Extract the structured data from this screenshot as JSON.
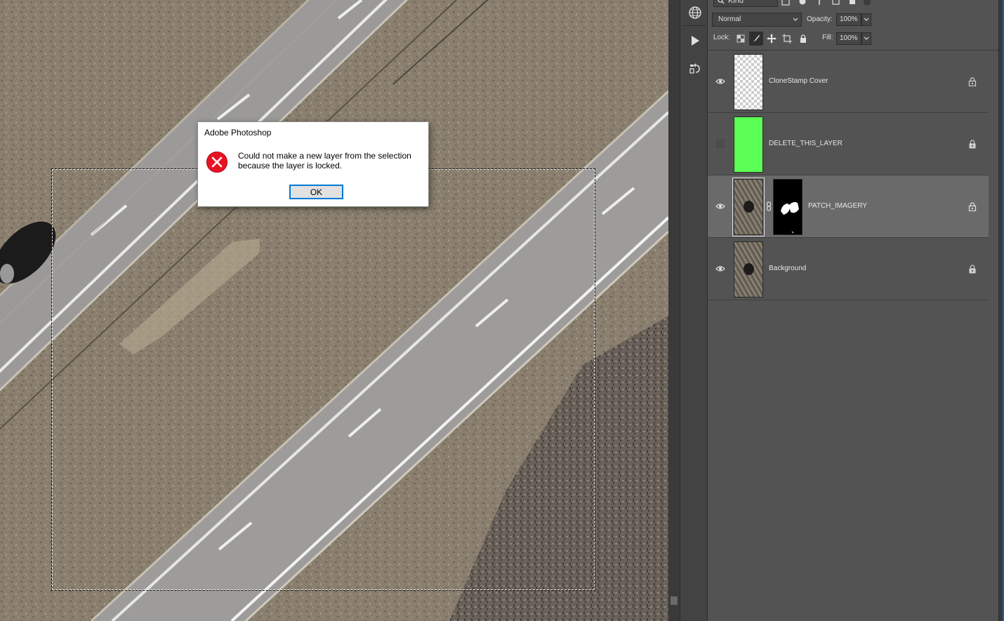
{
  "dialog": {
    "title": "Adobe Photoshop",
    "message_line1": "Could not make a new layer from the selection",
    "message_line2": "because the layer is locked.",
    "ok_label": "OK"
  },
  "layers_panel": {
    "filter_kind": "Kind",
    "blend_mode": "Normal",
    "opacity_label": "Opacity:",
    "opacity_value": "100%",
    "lock_label": "Lock:",
    "fill_label": "Fill:",
    "fill_value": "100%",
    "layers": [
      {
        "name": "CloneStamp Cover",
        "visible": true,
        "locked": true,
        "thumbnail": "transparent"
      },
      {
        "name": "DELETE_THIS_LAYER",
        "visible": false,
        "locked": true,
        "thumbnail": "green",
        "color": "#5cff55"
      },
      {
        "name": "PATCH_IMAGERY",
        "visible": true,
        "locked": true,
        "selected": true,
        "thumbnail": "aerial",
        "has_mask": true
      },
      {
        "name": "Background",
        "visible": true,
        "locked": true,
        "thumbnail": "aerial"
      }
    ]
  },
  "icons": {
    "dialog_icon": "error-icon",
    "panel_icons": [
      "globe-icon",
      "play-icon",
      "history-brush-icon"
    ]
  },
  "colors": {
    "panel_bg": "#535353",
    "selected_layer": "#6a6a6a",
    "accent": "#0078d7",
    "error_red": "#e81123"
  }
}
